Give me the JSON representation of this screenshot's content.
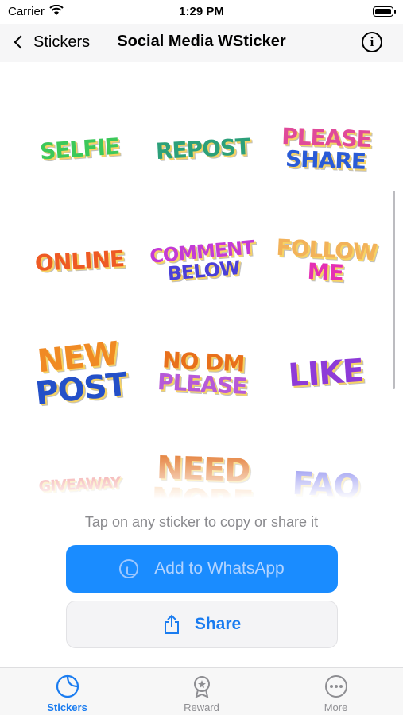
{
  "status_bar": {
    "carrier": "Carrier",
    "time": "1:29 PM"
  },
  "nav": {
    "back_label": "Stickers",
    "title": "Social Media WSticker",
    "info_icon": "info-icon"
  },
  "stickers": [
    {
      "lines": [
        "SELFIE"
      ],
      "colors": [
        "#3cc85a"
      ]
    },
    {
      "lines": [
        "REPOST"
      ],
      "colors": [
        "#2ca07a"
      ]
    },
    {
      "lines": [
        "PLEASE",
        "SHARE"
      ],
      "colors": [
        "#e04a9a",
        "#2a5bd6"
      ]
    },
    {
      "lines": [
        "ONLINE"
      ],
      "colors": [
        "#ee5a24"
      ]
    },
    {
      "lines": [
        "COMMENT",
        "BELOW"
      ],
      "colors": [
        "#c33bd6",
        "#4a3fd8"
      ]
    },
    {
      "lines": [
        "FOLLOW",
        "ME"
      ],
      "colors": [
        "#f2b25a",
        "#e42fb4"
      ]
    },
    {
      "lines": [
        "NEW",
        "POST"
      ],
      "colors": [
        "#f08a24",
        "#2450c8"
      ]
    },
    {
      "lines": [
        "NO DM",
        "PLEASE"
      ],
      "colors": [
        "#e8701c",
        "#b65ad8"
      ]
    },
    {
      "lines": [
        "LIKE"
      ],
      "colors": [
        "#8e3bd8"
      ]
    },
    {
      "lines": [
        "GIVEAWAY"
      ],
      "colors": [
        "#e85a5a"
      ]
    },
    {
      "lines": [
        "NEED",
        "MORE"
      ],
      "colors": [
        "#e06a18",
        "#f09a4a"
      ]
    },
    {
      "lines": [
        "FAQ"
      ],
      "colors": [
        "#5a5ae8"
      ]
    }
  ],
  "hint": "Tap on any sticker to copy or share it",
  "buttons": {
    "whatsapp": "Add to WhatsApp",
    "share": "Share"
  },
  "tabs": [
    {
      "label": "Stickers",
      "icon": "stickers-icon",
      "active": true
    },
    {
      "label": "Reward",
      "icon": "reward-icon",
      "active": false
    },
    {
      "label": "More",
      "icon": "more-icon",
      "active": false
    }
  ],
  "colors": {
    "accent": "#1a7cf0",
    "whatsapp_button": "#1a8cff"
  }
}
